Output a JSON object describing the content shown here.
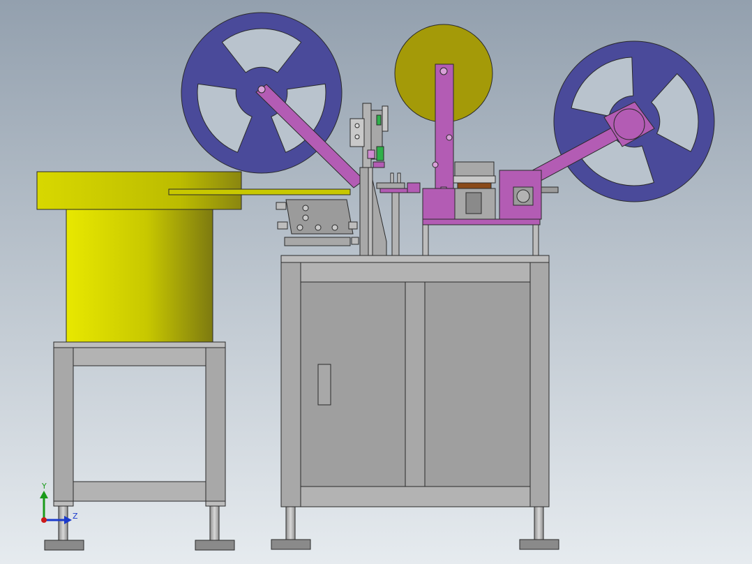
{
  "colors": {
    "background_top": "#93a0ae",
    "background_bottom": "#e6ebef",
    "reel_blue": "#4a4a9a",
    "reel_yellow": "#a49a08",
    "arm_magenta": "#b35cb4",
    "feeder_yellow": "#d4d400",
    "frame_gray": "#a6a6a6",
    "base_plate_gray": "#9b9b9b",
    "outline": "#2a2a2a",
    "axis_y": "#1a9a1a",
    "axis_z": "#1a3acc",
    "axis_x": "#cc1a1a"
  },
  "axes": {
    "y_label": "Y",
    "z_label": "Z"
  },
  "icons": {
    "reels": [
      "left-blue-spoked-reel",
      "center-yellow-tape-reel",
      "right-blue-spoked-reel"
    ],
    "triad": "coordinate-axis-triad-icon"
  }
}
